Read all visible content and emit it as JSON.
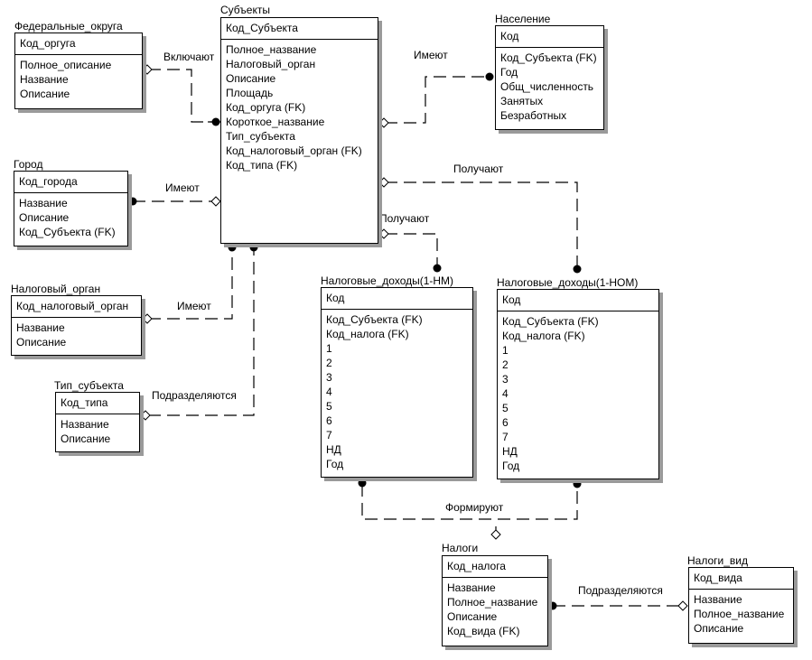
{
  "entities": [
    {
      "id": "federal",
      "title": "Федеральные_округа",
      "key": "Код_оргуга",
      "attributes": [
        "Полное_описание",
        "Название",
        "Описание"
      ]
    },
    {
      "id": "subjects",
      "title": "Субъекты",
      "key": "Код_Субъекта",
      "attributes": [
        "Полное_название",
        "Налоговый_орган",
        "Описание",
        "Площадь",
        "Код_оргуга (FK)",
        "Короткое_название",
        "Тип_субъекта",
        "Код_налоговый_орган (FK)",
        "Код_типа (FK)"
      ]
    },
    {
      "id": "population",
      "title": "Население",
      "key": "Код",
      "attributes": [
        "Код_Субъекта (FK)",
        "Год",
        "Общ_численность",
        "Занятых",
        "Безработных"
      ]
    },
    {
      "id": "city",
      "title": "Город",
      "key": "Код_города",
      "attributes": [
        "Название",
        "Описание",
        "Код_Субъекта (FK)"
      ]
    },
    {
      "id": "tax-authority",
      "title": "Налоговый_орган",
      "key": "Код_налоговый_орган",
      "attributes": [
        "Название",
        "Описание"
      ]
    },
    {
      "id": "subject-type",
      "title": "Тип_субъекта",
      "key": "Код_типа",
      "attributes": [
        "Название",
        "Описание"
      ]
    },
    {
      "id": "tax-income-nm",
      "title": "Налоговые_доходы(1-НМ)",
      "key": "Код",
      "attributes": [
        "Код_Субъекта (FK)",
        "Код_налога (FK)",
        "1",
        "2",
        "3",
        "4",
        "5",
        "6",
        "7",
        "НД",
        "Год"
      ]
    },
    {
      "id": "tax-income-nom",
      "title": "Налоговые_доходы(1-НОМ)",
      "key": "Код",
      "attributes": [
        "Код_Субъекта (FK)",
        "Код_налога (FK)",
        "1",
        "2",
        "3",
        "4",
        "5",
        "6",
        "7",
        "НД",
        "Год"
      ]
    },
    {
      "id": "taxes",
      "title": "Налоги",
      "key": "Код_налога",
      "attributes": [
        "Название",
        "Полное_название",
        "Описание",
        "Код_вида (FK)"
      ]
    },
    {
      "id": "tax-types",
      "title": "Налоги_вид",
      "key": "Код_вида",
      "attributes": [
        "Название",
        "Полное_название",
        "Описание"
      ]
    }
  ],
  "relationships": [
    {
      "label": "Включают",
      "from": "Федеральные_округа",
      "to": "Субъекты"
    },
    {
      "label": "Имеют",
      "from": "Город",
      "to": "Субъекты"
    },
    {
      "label": "Имеют",
      "from": "Налоговый_орган",
      "to": "Субъекты"
    },
    {
      "label": "Подразделяются",
      "from": "Тип_субъекта",
      "to": "Субъекты"
    },
    {
      "label": "Имеют",
      "from": "Субъекты",
      "to": "Население"
    },
    {
      "label": "Получают",
      "from": "Субъекты",
      "to": "Налоговые_доходы(1-НОМ)"
    },
    {
      "label": "Получают",
      "from": "Субъекты",
      "to": "Налоговые_доходы(1-НМ)"
    },
    {
      "label": "Формируют",
      "from": "Налоговые_доходы",
      "to": "Налоги"
    },
    {
      "label": "Подразделяются",
      "from": "Налоги",
      "to": "Налоги_вид"
    }
  ]
}
